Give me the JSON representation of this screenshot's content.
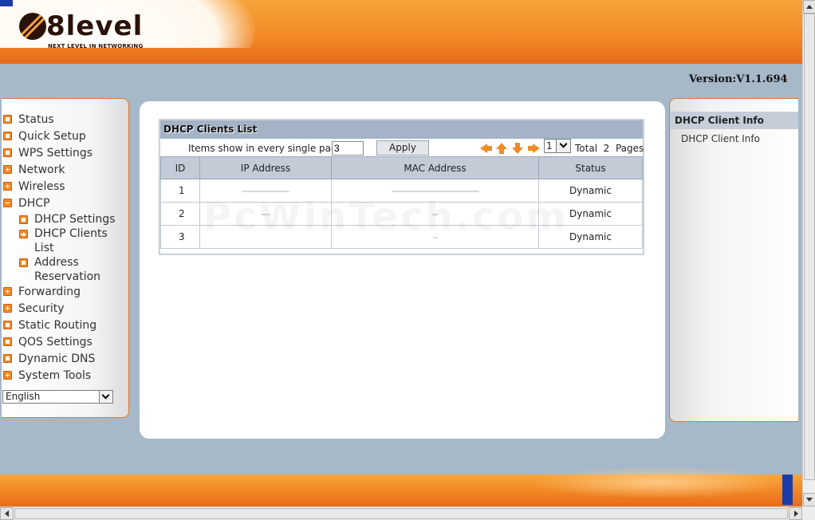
{
  "header": {
    "logo_text": "8level",
    "logo_tagline": "NEXT LEVEL IN NETWORKING",
    "version": "Version:V1.1.694"
  },
  "sidebar": {
    "items": [
      {
        "label": "Status",
        "icon": "square-bullet-icon"
      },
      {
        "label": "Quick Setup",
        "icon": "square-bullet-icon"
      },
      {
        "label": "WPS Settings",
        "icon": "square-bullet-icon"
      },
      {
        "label": "Network",
        "icon": "plus-expand-icon"
      },
      {
        "label": "Wireless",
        "icon": "plus-expand-icon"
      },
      {
        "label": "DHCP",
        "icon": "minus-collapse-icon"
      },
      {
        "label": "Forwarding",
        "icon": "plus-expand-icon"
      },
      {
        "label": "Security",
        "icon": "plus-expand-icon"
      },
      {
        "label": "Static Routing",
        "icon": "square-bullet-icon"
      },
      {
        "label": "QOS Settings",
        "icon": "square-bullet-icon"
      },
      {
        "label": "Dynamic DNS",
        "icon": "square-bullet-icon"
      },
      {
        "label": "System Tools",
        "icon": "plus-expand-icon"
      }
    ],
    "dhcp_sub": [
      {
        "label_line1": "DHCP Settings",
        "label_line2": ""
      },
      {
        "label_line1": "DHCP Clients",
        "label_line2": "List"
      },
      {
        "label_line1": "Address",
        "label_line2": "Reservation"
      }
    ],
    "language": "English"
  },
  "main": {
    "table_title": "DHCP Clients List",
    "items_label": "Items show in every single page",
    "items_per_page": "3",
    "apply_label": "Apply",
    "page_selected": "1",
    "total_label": "Total",
    "total_pages": "2",
    "pages_label": "Pages",
    "columns": [
      "ID",
      "IP Address",
      "MAC Address",
      "Status"
    ],
    "rows": [
      {
        "id": "1",
        "ip": "",
        "mac": "",
        "status": "Dynamic"
      },
      {
        "id": "2",
        "ip": "",
        "mac": "",
        "status": "Dynamic"
      },
      {
        "id": "3",
        "ip": "",
        "mac": "",
        "status": "Dynamic"
      }
    ],
    "watermark": "PcWinTech.com"
  },
  "rightbar": {
    "title": "DHCP Client Info",
    "item": "DHCP Client Info"
  },
  "colors": {
    "accent_orange": "#f28a26",
    "header_blue_gray": "#a4b4c6",
    "page_bg": "#a7b8c8"
  }
}
